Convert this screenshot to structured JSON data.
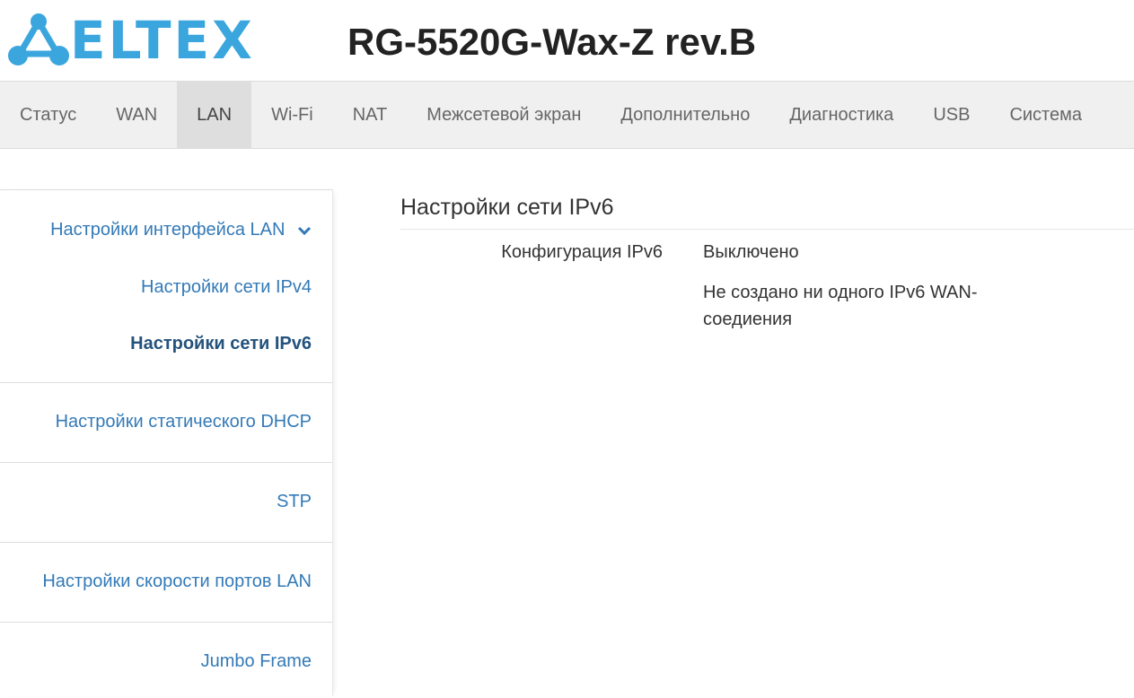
{
  "header": {
    "brand": "ELTEX",
    "device_title": "RG-5520G-Wax-Z rev.B"
  },
  "nav": {
    "items": [
      {
        "label": "Статус"
      },
      {
        "label": "WAN"
      },
      {
        "label": "LAN"
      },
      {
        "label": "Wi-Fi"
      },
      {
        "label": "NAT"
      },
      {
        "label": "Межсетевой экран"
      },
      {
        "label": "Дополнительно"
      },
      {
        "label": "Диагностика"
      },
      {
        "label": "USB"
      },
      {
        "label": "Система"
      }
    ],
    "active": "LAN"
  },
  "sidebar": {
    "group_lan": "Настройки интерфейса LAN",
    "ipv4": "Настройки сети IPv4",
    "ipv6": "Настройки сети IPv6",
    "static_dhcp": "Настройки статического DHCP",
    "stp": "STP",
    "port_speed": "Настройки скорости портов LAN",
    "jumbo": "Jumbo Frame"
  },
  "main": {
    "title": "Настройки сети IPv6",
    "config_label": "Конфигурация IPv6",
    "config_value": "Выключено",
    "note": "Не создано ни одного IPv6 WAN-соедиения"
  },
  "colors": {
    "brand": "#3aa6dd",
    "link": "#337ab7",
    "link_active": "#23527c",
    "nav_bg": "#f0f0f0"
  }
}
